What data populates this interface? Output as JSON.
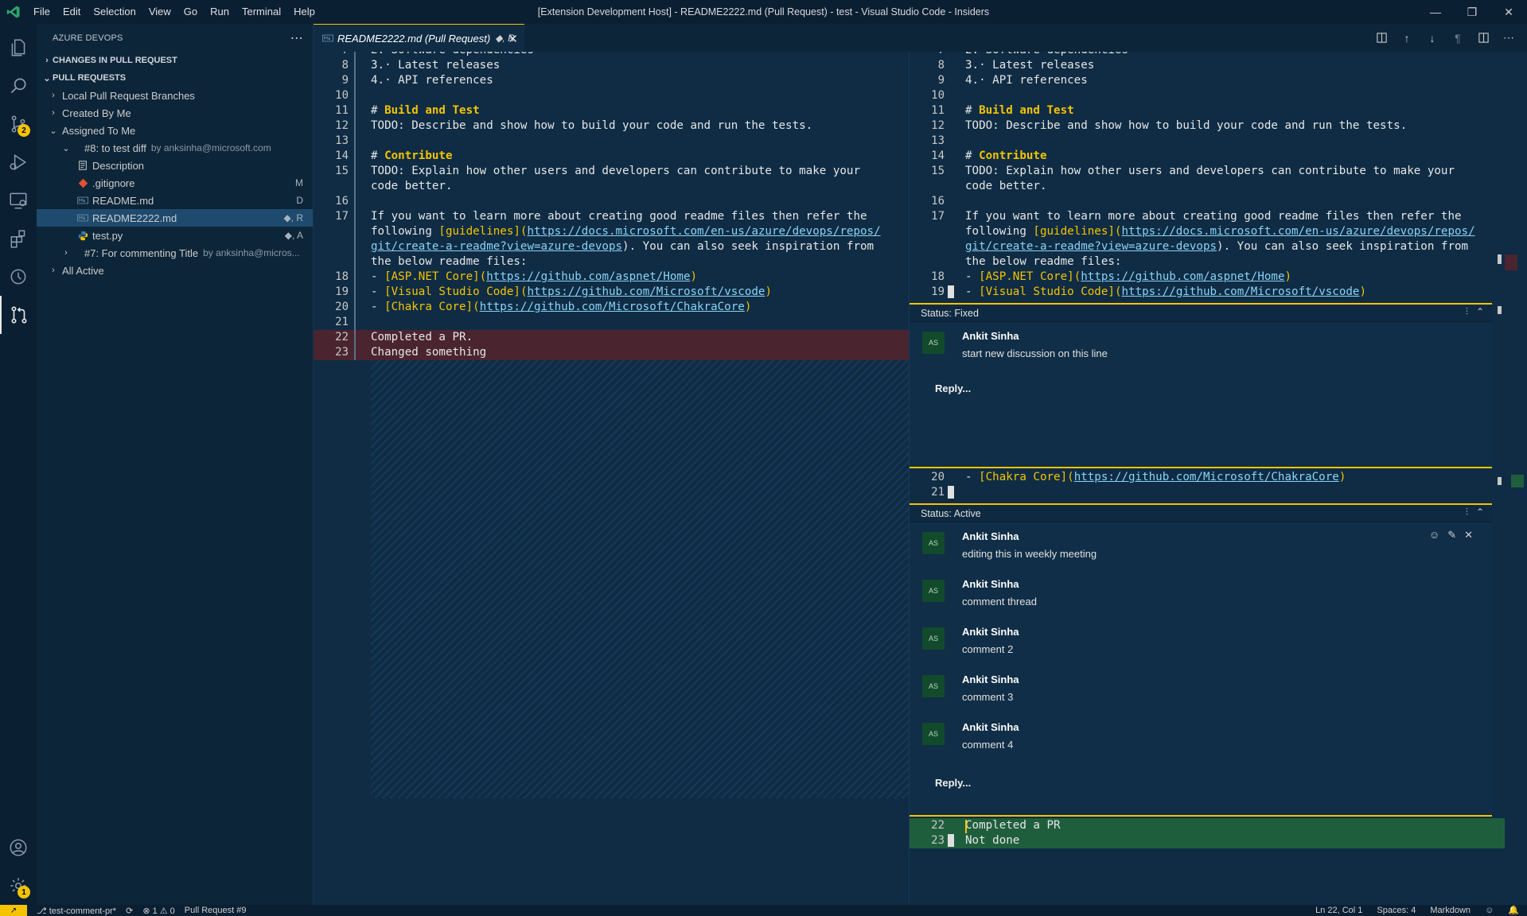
{
  "window": {
    "title": "[Extension Development Host] - README2222.md (Pull Request) - test - Visual Studio Code - Insiders",
    "menu": [
      "File",
      "Edit",
      "Selection",
      "View",
      "Go",
      "Run",
      "Terminal",
      "Help"
    ]
  },
  "activity": {
    "scm_badge": "2",
    "settings_badge": "1"
  },
  "sidebar": {
    "title": "AZURE DEVOPS",
    "sections": {
      "changes": "CHANGES IN PULL REQUEST",
      "prs": "PULL REQUESTS"
    },
    "tree": {
      "local": "Local Pull Request Branches",
      "created": "Created By Me",
      "assigned": "Assigned To Me",
      "pr8": {
        "label": "#8: to test diff",
        "desc": "by anksinha@microsoft.com"
      },
      "description": "Description",
      "files": [
        {
          "label": ".gitignore",
          "deco": "M",
          "icon": "git-icon"
        },
        {
          "label": "README.md",
          "deco": "D",
          "icon": "markdown-icon"
        },
        {
          "label": "README2222.md",
          "deco": "◆, R",
          "icon": "markdown-icon"
        },
        {
          "label": "test.py",
          "deco": "◆, A",
          "icon": "python-icon"
        }
      ],
      "pr7": {
        "label": "#7: For commenting Title",
        "desc": "by anksinha@micros..."
      },
      "all_active": "All Active"
    }
  },
  "tab": {
    "label": "README2222.md (Pull Request)",
    "deco": "◆, R"
  },
  "code": {
    "top_partial": "2.·Software·dependencies",
    "lines": {
      "l8": "3.· Latest releases",
      "l9": "4.· API references",
      "l11_hash": "# ",
      "l11_head": "Build and Test",
      "l12": "TODO: Describe and show how to build your code and run the tests.",
      "l14_hash": "# ",
      "l14_head": "Contribute",
      "l15a": "TODO: Explain how other users and developers can contribute to make your",
      "l15b": "code better.",
      "l17a": "If you want to learn more about creating good readme files then refer the",
      "l17b_pre": "following ",
      "l17b_link": "[guidelines]",
      "l17b_paren": "(",
      "l17b_url": "https://docs.microsoft.com/en-us/azure/devops/repos/",
      "l17c_url": "git/create-a-readme?view=azure-devops",
      "l17c_post": "). You can also seek inspiration from",
      "l17d": "the below readme files:",
      "l18_pre": "- ",
      "l18_link": "[ASP.NET Core]",
      "l18_url": "https://github.com/aspnet/Home",
      "l19_pre": "- ",
      "l19_link": "[Visual Studio Code]",
      "l19_url": "https://github.com/Microsoft/vscode",
      "l20_pre": "- ",
      "l20_link": "[Chakra Core]",
      "l20_url": "https://github.com/Microsoft/ChakraCore"
    },
    "left_removed": [
      "Completed a PR.",
      "Changed something"
    ],
    "right_added": [
      "Completed a PR",
      "Not done"
    ],
    "numbers": {
      "n8": "8",
      "n9": "9",
      "n10": "10",
      "n11": "11",
      "n12": "12",
      "n13": "13",
      "n14": "14",
      "n15": "15",
      "n16": "16",
      "n17": "17",
      "n18": "18",
      "n19": "19",
      "n20": "20",
      "n21": "21",
      "n22": "22",
      "n23": "23"
    }
  },
  "threads": {
    "fixed": {
      "status": "Status: Fixed",
      "comments": [
        {
          "initials": "AS",
          "author": "Ankit Sinha",
          "body": "start new discussion on this line"
        }
      ],
      "reply": "Reply..."
    },
    "active": {
      "status": "Status: Active",
      "comments": [
        {
          "initials": "AS",
          "author": "Ankit Sinha",
          "body": "editing this in weekly meeting"
        },
        {
          "initials": "AS",
          "author": "Ankit Sinha",
          "body": "comment thread"
        },
        {
          "initials": "AS",
          "author": "Ankit Sinha",
          "body": "comment 2"
        },
        {
          "initials": "AS",
          "author": "Ankit Sinha",
          "body": "comment 3"
        },
        {
          "initials": "AS",
          "author": "Ankit Sinha",
          "body": "comment 4"
        }
      ],
      "reply": "Reply..."
    }
  },
  "statusbar": {
    "branch": "test-comment-pr*",
    "sync": "⟳",
    "problems": "⊗ 1 ⚠ 0",
    "pr": "Pull Request #9",
    "position": "Ln 22, Col 1",
    "spaces": "Spaces: 4",
    "language": "Markdown"
  },
  "colors": {
    "accent": "#f5c400",
    "editor_bg": "#0f2c44",
    "added": "#1f5e3d",
    "removed": "#4a2530"
  }
}
